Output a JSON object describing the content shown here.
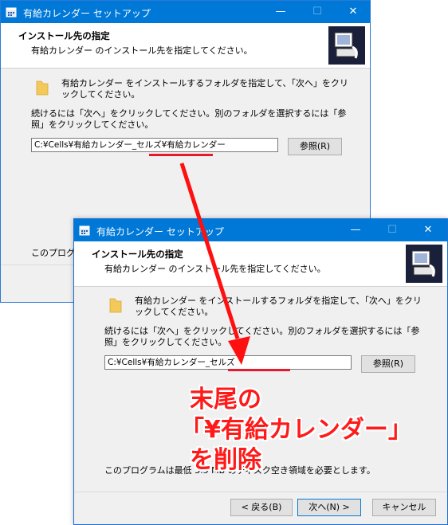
{
  "windows": {
    "back": {
      "title": "有給カレンダー セットアップ",
      "header_title": "インストール先の指定",
      "header_subtitle": "有給カレンダー のインストール先を指定してください。",
      "body_line1": "有給カレンダー をインストールするフォルダを指定して、「次へ」をクリックしてください。",
      "body_line2": "続けるには「次へ」をクリックしてください。別のフォルダを選択するには「参照」をクリックしてください。",
      "path_value": "C:¥Cells¥有給カレンダー_セルズ¥有給カレンダー",
      "browse_label": "参照(R)",
      "program_note_partial": "このプログラ"
    },
    "front": {
      "title": "有給カレンダー セットアップ",
      "header_title": "インストール先の指定",
      "header_subtitle": "有給カレンダー のインストール先を指定してください。",
      "body_line1": "有給カレンダー をインストールするフォルダを指定して、「次へ」をクリックしてください。",
      "body_line2": "続けるには「次へ」をクリックしてください。別のフォルダを選択するには「参照」をクリックしてください。",
      "path_value": "C:¥Cells¥有給カレンダー_セルズ",
      "browse_label": "参照(R)",
      "program_note": "このプログラムは最低 3.5 MB のディスク空き領域を必要とします。",
      "back_label": "< 戻る(B)",
      "next_label": "次へ(N) >",
      "cancel_label": "キャンセル"
    }
  },
  "titlebar_controls": {
    "minimize": "—",
    "maximize": "☐",
    "close": "✕"
  },
  "annotation": {
    "line1": "末尾の",
    "line2": "「¥有給カレンダー」",
    "line3": "を削除"
  },
  "colors": {
    "accent": "#0078d7",
    "annotation_red": "#e8192c"
  }
}
